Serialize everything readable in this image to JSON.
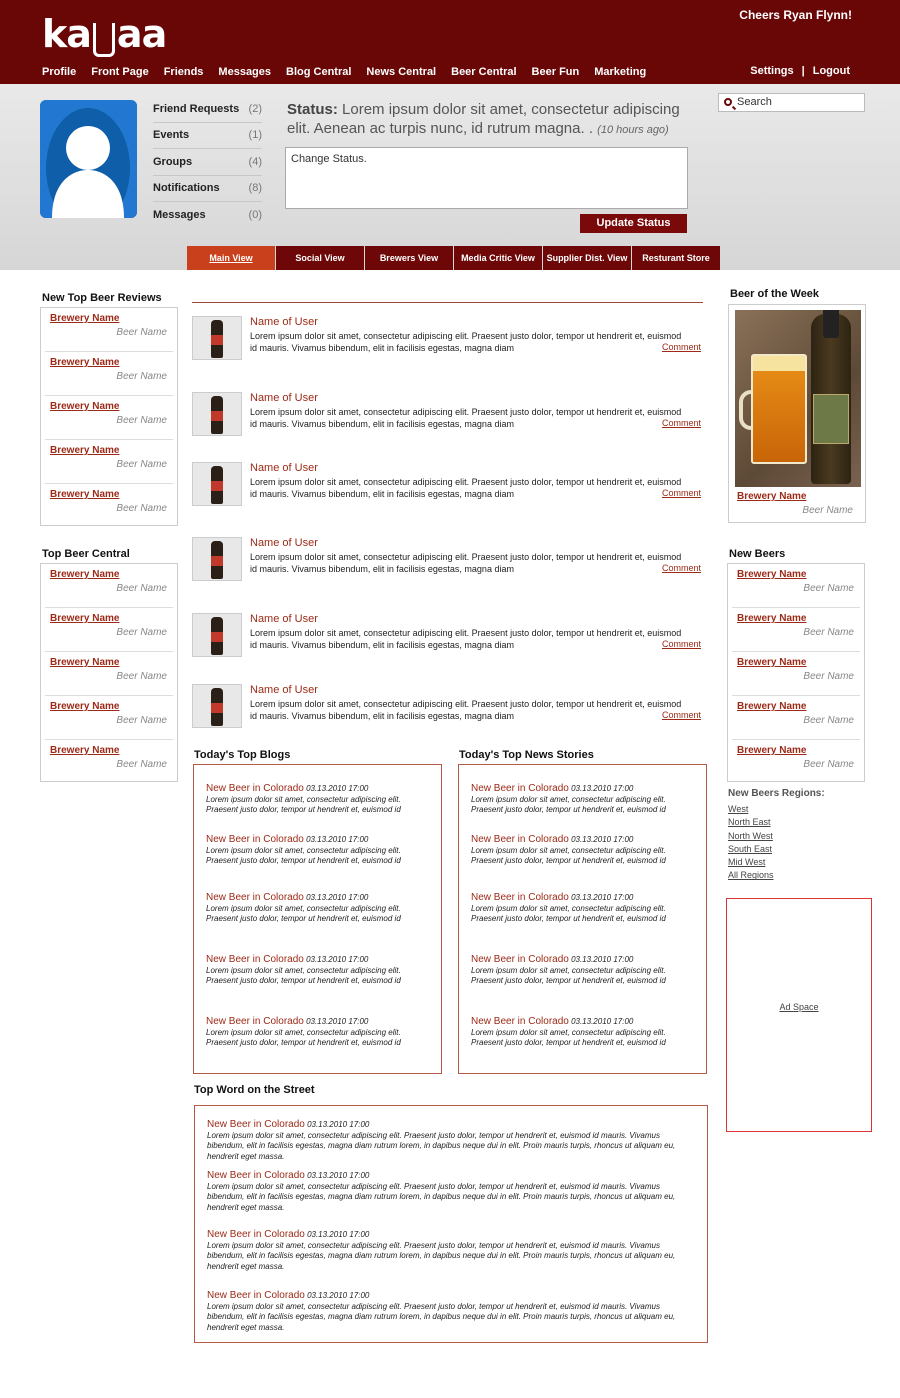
{
  "brand": {
    "logo_text": "kabaa",
    "logo_prefix": "ka",
    "logo_suffix": "aa"
  },
  "header": {
    "greeting": "Cheers Ryan Flynn!"
  },
  "nav": {
    "items": [
      "Profile",
      "Front Page",
      "Friends",
      "Messages",
      "Blog Central",
      "News Central",
      "Beer Central",
      "Beer Fun",
      "Marketing"
    ],
    "settings": "Settings",
    "separator": "|",
    "logout": "Logout"
  },
  "profile": {
    "counts": [
      {
        "label": "Friend Requests",
        "count": "(2)"
      },
      {
        "label": "Events",
        "count": "(1)"
      },
      {
        "label": "Groups",
        "count": "(4)"
      },
      {
        "label": "Notifications",
        "count": "(8)"
      },
      {
        "label": "Messages",
        "count": "(0)"
      }
    ],
    "status_label": "Status:",
    "status_text": "Lorem ipsum dolor sit amet, consectetur adipiscing elit. Aenean ac turpis nunc, id rutrum magna. .",
    "status_ago": "(10 hours ago)",
    "status_input": "Change Status.",
    "update_button": "Update Status"
  },
  "search": {
    "label": "Search"
  },
  "view_tabs": [
    "Main View",
    "Social View",
    "Brewers View",
    "Media Critic View",
    "Supplier Dist. View",
    "Resturant Store"
  ],
  "sidebar": {
    "top_reviews_title": "New Top Beer Reviews",
    "top_beer_central_title": "Top Beer Central",
    "brewery_label": "Brewery Name",
    "beer_label": "Beer Name"
  },
  "feed": {
    "name": "Name of User",
    "text": "Lorem ipsum dolor sit amet, consectetur adipiscing elit. Praesent justo dolor, tempor ut hendrerit et, euismod id mauris. Vivamus bibendum, elit in facilisis egestas, magna diam",
    "comment": "Comment"
  },
  "blogs": {
    "title": "Today's Top Blogs",
    "news_title": "Today's Top News Stories",
    "street_title": "Top Word on the Street",
    "item_title": "New Beer in Colorado",
    "item_date": "03.13.2010 17:00",
    "item_text": "Lorem ipsum dolor sit amet, consectetur adipiscing elit. Praesent justo dolor, tempor ut hendrerit et, euismod id",
    "street_text": "Lorem ipsum dolor sit amet, consectetur adipiscing elit. Praesent justo dolor, tempor ut hendrerit et, euismod id mauris. Vivamus bibendum, elit in facilisis egestas, magna diam rutrum lorem, in dapibus neque dui in elit. Proin mauris turpis, rhoncus ut aliquam eu, hendrerit eget massa."
  },
  "right": {
    "beer_of_week_title": "Beer of the Week",
    "new_beers_title": "New Beers",
    "regions_title": "New Beers Regions:",
    "regions": [
      "West",
      "North East",
      "North West",
      "South East",
      "Mid West",
      "All Regions"
    ],
    "ad": "Ad Space"
  },
  "colors": {
    "header": "#690707",
    "accent": "#9b2a17",
    "active_tab": "#c9401c"
  }
}
